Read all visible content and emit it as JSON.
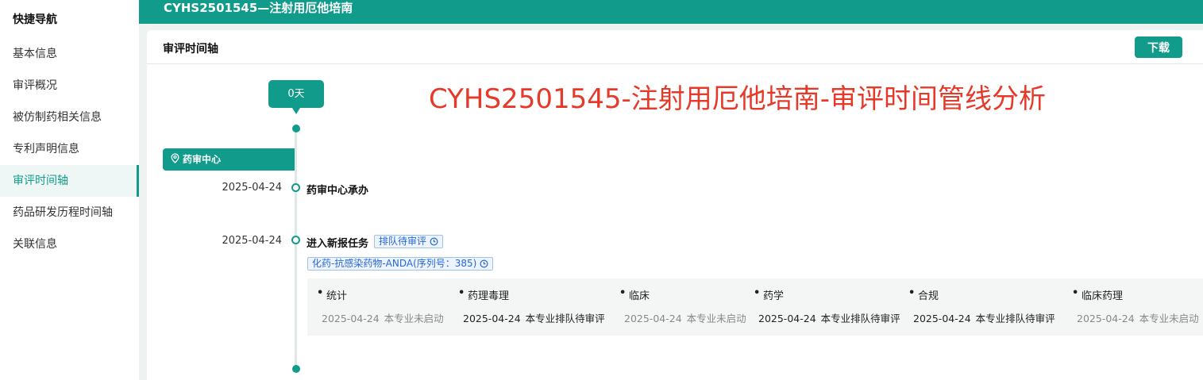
{
  "sidebar": {
    "title": "快捷导航",
    "items": [
      {
        "label": "基本信息"
      },
      {
        "label": "审评概况"
      },
      {
        "label": "被仿制药相关信息"
      },
      {
        "label": "专利声明信息"
      },
      {
        "label": "审评时间轴",
        "active": true
      },
      {
        "label": "药品研发历程时间轴"
      },
      {
        "label": "关联信息"
      }
    ]
  },
  "topbar": {
    "title": "CYHS2501545—注射用厄他培南"
  },
  "card": {
    "title": "审评时间轴",
    "download_label": "下载"
  },
  "annotation": "CYHS2501545-注射用厄他培南-审评时间管线分析",
  "timeline": {
    "day_label": "0天",
    "center": "药审中心",
    "events": [
      {
        "date": "2025-04-24",
        "title": "药审中心承办"
      },
      {
        "date": "2025-04-24",
        "title": "进入新报任务",
        "status_chip": "排队待审评",
        "category_chip": "化药-抗感染药物-ANDA(序列号：385)"
      }
    ],
    "specialties": [
      {
        "name": "统计",
        "date": "2025-04-24",
        "status": "本专业未启动",
        "tone": "muted"
      },
      {
        "name": "药理毒理",
        "date": "2025-04-24",
        "status": "本专业排队待审评",
        "tone": "dark"
      },
      {
        "name": "临床",
        "date": "2025-04-24",
        "status": "本专业未启动",
        "tone": "muted"
      },
      {
        "name": "药学",
        "date": "2025-04-24",
        "status": "本专业排队待审评",
        "tone": "dark"
      },
      {
        "name": "合规",
        "date": "2025-04-24",
        "status": "本专业排队待审评",
        "tone": "dark"
      },
      {
        "name": "临床药理",
        "date": "2025-04-24",
        "status": "本专业未启动",
        "tone": "muted"
      }
    ]
  },
  "colors": {
    "brand": "#119b8b",
    "annotation": "#e53a2a",
    "chip_text": "#2867d6"
  }
}
